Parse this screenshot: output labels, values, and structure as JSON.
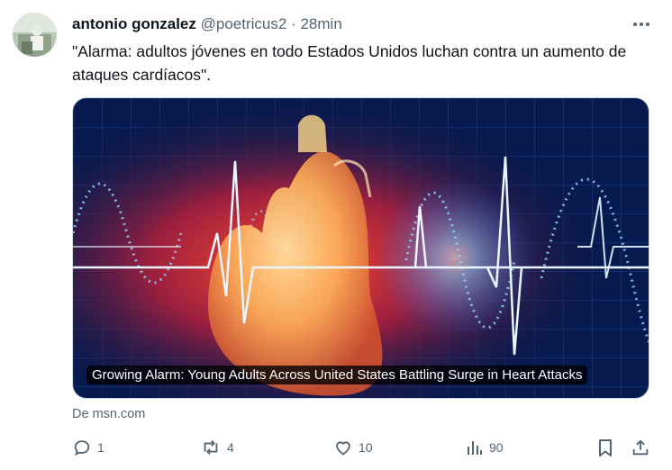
{
  "tweet": {
    "author_name": "antonio gonzalez",
    "handle": "@poetricus2",
    "separator": "·",
    "time": "28min",
    "text": "\"Alarma: adultos jóvenes en todo Estados Unidos luchan contra un aumento de ataques cardíacos\".",
    "card": {
      "title": "Growing Alarm: Young Adults Across United States Battling Surge in Heart Attacks",
      "source": "De msn.com"
    },
    "actions": {
      "replies": "1",
      "retweets": "4",
      "likes": "10",
      "views": "90"
    }
  },
  "icons": [
    "more-icon",
    "reply-icon",
    "retweet-icon",
    "like-icon",
    "views-icon",
    "bookmark-icon",
    "share-icon"
  ],
  "colors": {
    "text": "#0f1419",
    "muted": "#536471",
    "accent_blue": "#1d9bf0"
  }
}
